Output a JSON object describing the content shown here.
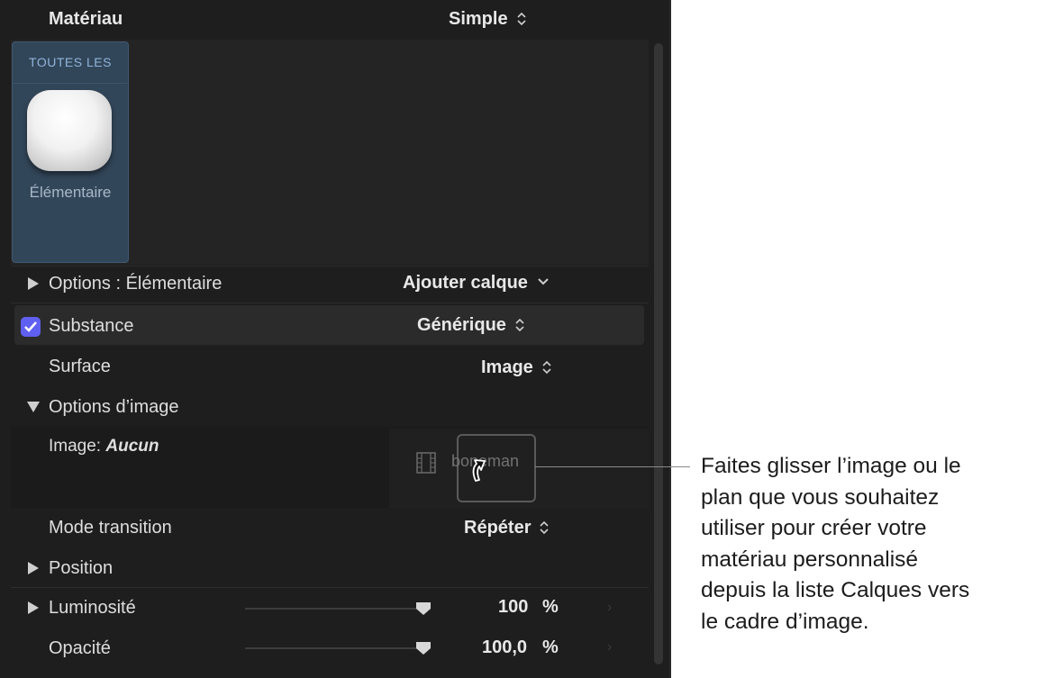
{
  "header": {
    "title": "Matériau",
    "mode_value": "Simple"
  },
  "library": {
    "category_label": "TOUTES LES",
    "material_name": "Élémentaire"
  },
  "rows": {
    "options": {
      "label": "Options : Élémentaire",
      "action": "Ajouter calque"
    },
    "substance": {
      "label": "Substance",
      "value": "Générique",
      "checked": true
    },
    "surface": {
      "label": "Surface",
      "value": "Image"
    },
    "image_options": {
      "label": "Options d’image"
    },
    "image": {
      "label": "Image:",
      "value": "Aucun",
      "drag_text": "boneman"
    },
    "mode_transition": {
      "label": "Mode transition",
      "value": "Répéter"
    },
    "position": {
      "label": "Position"
    },
    "luminosite": {
      "label": "Luminosité",
      "value": "100",
      "unit": "%"
    },
    "opacite": {
      "label": "Opacité",
      "value": "100,0",
      "unit": "%"
    }
  },
  "icons": [
    "updown-arrows-icon",
    "chevron-down-icon",
    "disclosure-triangle-icon",
    "checkbox-icon",
    "film-strip-icon",
    "drag-cursor-icon",
    "slider-knob-icon"
  ],
  "colors": {
    "panel_bg": "#1e1e1e",
    "tile_bg": "#324659",
    "checkbox": "#5f5ff2",
    "category_text": "#8fb4dc"
  },
  "callout": {
    "text": "Faites glisser l’image ou le\nplan que vous souhaitez\nutiliser pour créer votre\nmatériau personnalisé\ndepuis la liste Calques vers\nle cadre d’image."
  }
}
